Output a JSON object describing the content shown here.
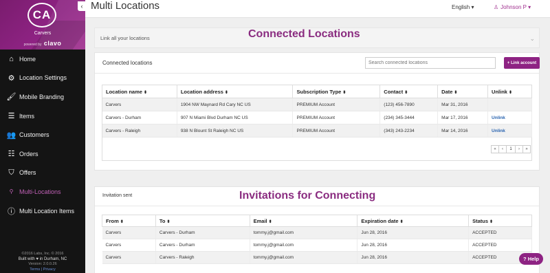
{
  "sidebar": {
    "avatar_initials": "CA",
    "brand_name": "Carvers",
    "powered_by": "powered by",
    "powered_logo": "clavo",
    "collapse_icon": "chevron-left-icon",
    "items": [
      {
        "label": "Home",
        "icon": "home-icon",
        "active": false
      },
      {
        "label": "Location Settings",
        "icon": "gear-icon",
        "active": false
      },
      {
        "label": "Mobile Branding",
        "icon": "paint-roller-icon",
        "active": false
      },
      {
        "label": "Items",
        "icon": "items-icon",
        "active": false
      },
      {
        "label": "Customers",
        "icon": "customers-icon",
        "active": false
      },
      {
        "label": "Orders",
        "icon": "orders-icon",
        "active": false
      },
      {
        "label": "Offers",
        "icon": "tag-icon",
        "active": false
      },
      {
        "label": "Multi-Locations",
        "icon": "multi-location-icon",
        "active": true
      },
      {
        "label": "Multi Location Items",
        "icon": "info-circle-icon",
        "active": false
      }
    ],
    "footer": {
      "copyright": "©2016 Labs, Inc. © 2016",
      "built_with": "Built with ♥ in Durham, NC",
      "version": "Version: 2.0.0.26",
      "links": "Terms | Privacy"
    }
  },
  "topbar": {
    "title": "Multi Locations",
    "language": "English",
    "user_name": "Johnson P"
  },
  "link_all": {
    "label": "Link all your locations"
  },
  "overlays": {
    "connected_title": "Connected Locations",
    "invitations_title": "Invitations for Connecting"
  },
  "connected": {
    "heading": "Connected locations",
    "search_placeholder": "Search connected locations",
    "link_button": "+ Link account",
    "columns": [
      "Location name",
      "Location address",
      "Subscription Type",
      "Contact",
      "Date",
      "Unlink"
    ],
    "rows": [
      {
        "name": "Carvers",
        "address": "1904 NW Maynard Rd Cary NC US",
        "subscription": "PREMIUM Account",
        "contact": "(123) 456-7890",
        "date": "Mar 31, 2016",
        "unlink": ""
      },
      {
        "name": "Carvers - Durham",
        "address": "907 N Miami Blvd Durham NC US",
        "subscription": "PREMIUM Account",
        "contact": "(234) 345-3444",
        "date": "Mar 17, 2016",
        "unlink": "Unlink"
      },
      {
        "name": "Carvers - Raleigh",
        "address": "938 N Blount St Raleigh NC US",
        "subscription": "PREMIUM Account",
        "contact": "(343) 243-2234",
        "date": "Mar 14, 2016",
        "unlink": "Unlink"
      }
    ],
    "pager": [
      "«",
      "‹",
      "1",
      "›",
      "»"
    ]
  },
  "invitations": {
    "heading": "Invitation sent",
    "columns": [
      "From",
      "To",
      "Email",
      "Expiration date",
      "Status"
    ],
    "rows": [
      {
        "from": "Carvers",
        "to": "Carvers - Durham",
        "email": "tommy.j@gmail.com",
        "expiration": "Jun 28, 2016",
        "status": "ACCEPTED"
      },
      {
        "from": "Carvers",
        "to": "Carvers - Durham",
        "email": "tommy.j@gmail.com",
        "expiration": "Jun 28, 2016",
        "status": "ACCEPTED"
      },
      {
        "from": "Carvers",
        "to": "Carvers - Raleigh",
        "email": "tommy.j@gmail.com",
        "expiration": "Jun 28, 2016",
        "status": "ACCEPTED"
      }
    ]
  },
  "help_button": "? Help",
  "colors": {
    "brand": "#8e2383",
    "link": "#2a64b0",
    "sidebar_bg": "#141414",
    "active_nav": "#c061b6"
  }
}
